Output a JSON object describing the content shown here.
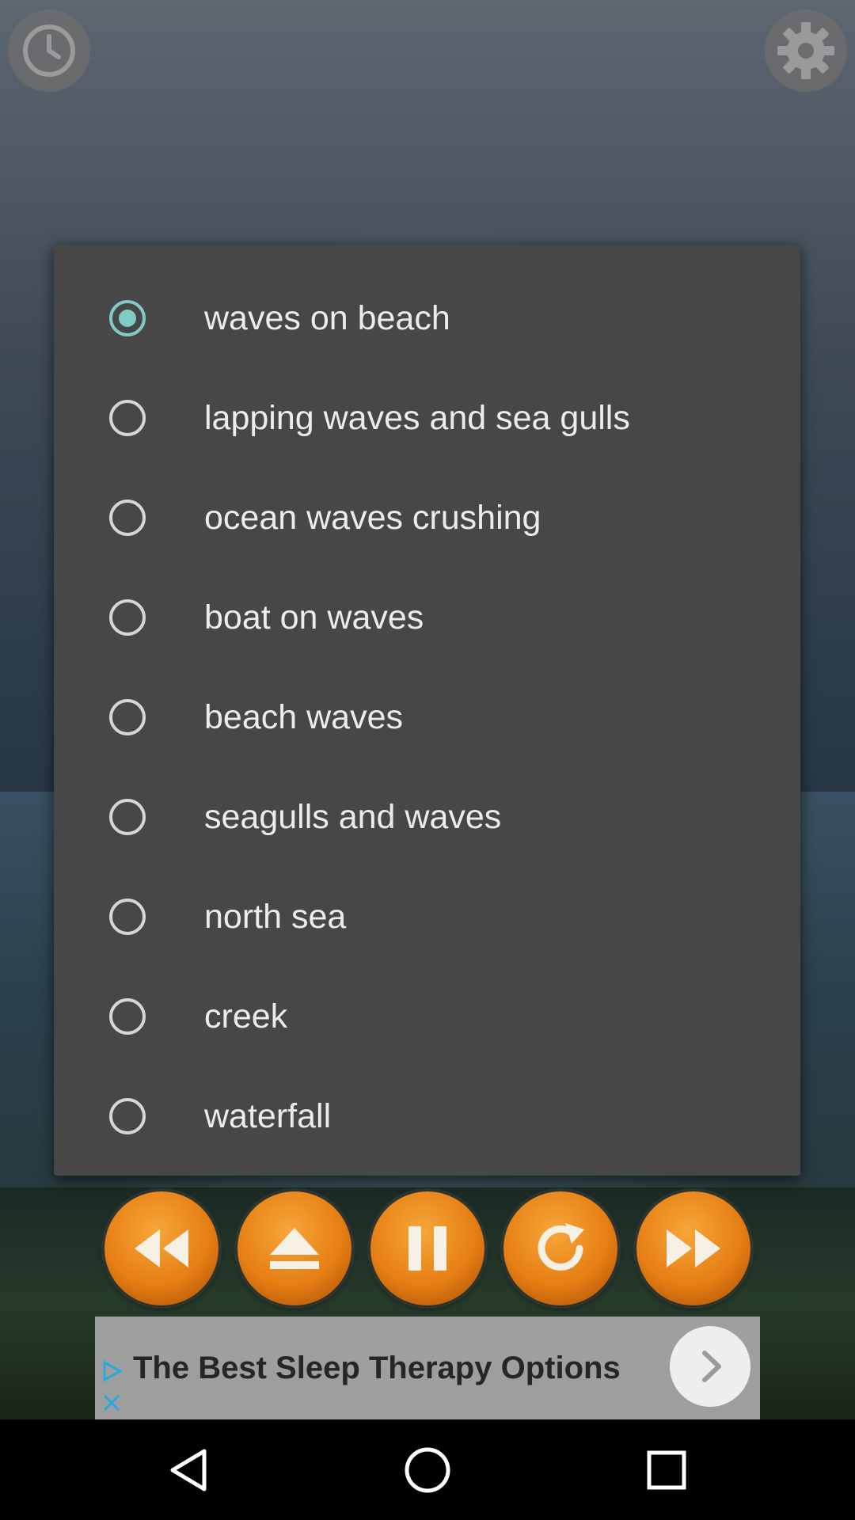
{
  "sound_options": [
    {
      "label": "waves on beach",
      "checked": true
    },
    {
      "label": "lapping waves and sea gulls",
      "checked": false
    },
    {
      "label": "ocean waves crushing",
      "checked": false
    },
    {
      "label": "boat on waves",
      "checked": false
    },
    {
      "label": "beach waves",
      "checked": false
    },
    {
      "label": "seagulls and waves",
      "checked": false
    },
    {
      "label": "north sea",
      "checked": false
    },
    {
      "label": "creek",
      "checked": false
    },
    {
      "label": "waterfall",
      "checked": false
    }
  ],
  "ad": {
    "text": "The Best Sleep Therapy Options"
  },
  "colors": {
    "accent": "#80cbc4",
    "dialog_bg": "#474747",
    "control_orange": "#e67e14"
  },
  "icons": {
    "top_left": "clock-icon",
    "top_right": "gear-icon",
    "controls": [
      "rewind-icon",
      "eject-icon",
      "pause-icon",
      "replay-icon",
      "fast-forward-icon"
    ],
    "nav": [
      "back-icon",
      "home-icon",
      "recents-icon"
    ]
  }
}
